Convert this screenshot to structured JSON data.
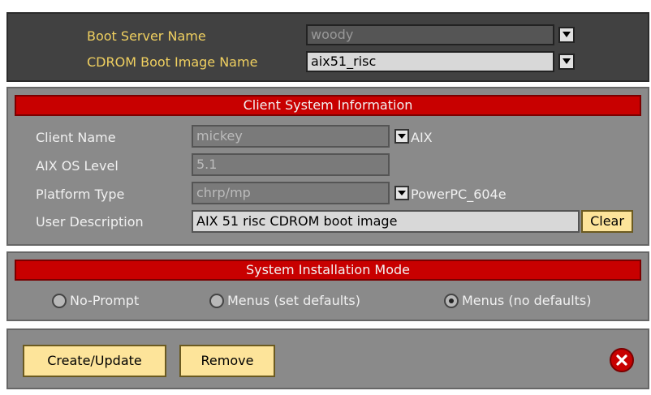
{
  "boot": {
    "server_label": "Boot Server Name",
    "server_value": "woody",
    "image_label": "CDROM Boot Image Name",
    "image_value": "aix51_risc"
  },
  "client": {
    "title": "Client System Information",
    "name_label": "Client Name",
    "name_value": "mickey",
    "os_type": "AIX",
    "os_level_label": "AIX OS Level",
    "os_level_value": "5.1",
    "platform_label": "Platform Type",
    "platform_value": "chrp/mp",
    "processor": "PowerPC_604e",
    "desc_label": "User Description",
    "desc_value": "AIX 51 risc CDROM boot image",
    "clear_label": "Clear"
  },
  "install": {
    "title": "System Installation Mode",
    "options": [
      "No-Prompt",
      "Menus (set defaults)",
      "Menus (no defaults)"
    ],
    "selected": "Menus (no defaults)"
  },
  "actions": {
    "create_label": "Create/Update",
    "remove_label": "Remove"
  },
  "colors": {
    "header_red": "#c80000",
    "button_yellow": "#fde49a",
    "label_yellow": "#f0d060"
  }
}
